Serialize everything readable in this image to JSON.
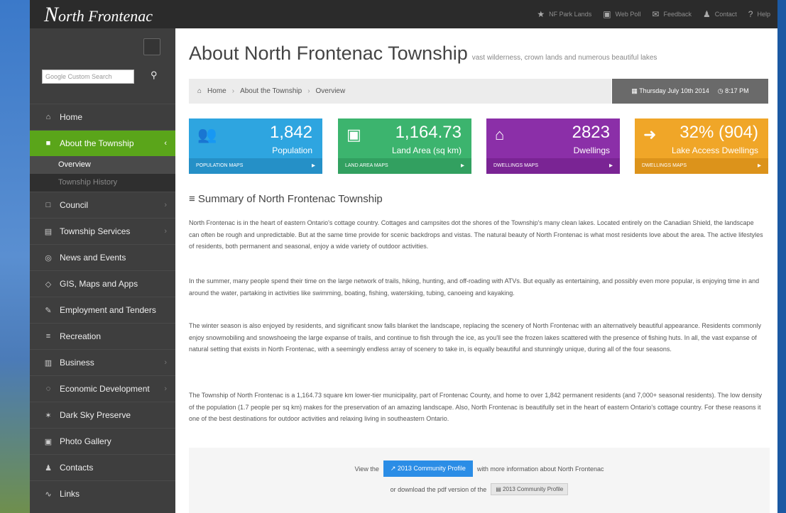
{
  "site": {
    "logo_initial": "N",
    "logo_rest": "orth Frontenac"
  },
  "topnav": [
    {
      "icon": "star-icon",
      "glyph": "★",
      "label": "NF Park Lands"
    },
    {
      "icon": "image-icon",
      "glyph": "▣",
      "label": "Web Poll"
    },
    {
      "icon": "comment-icon",
      "glyph": "✉",
      "label": "Feedback"
    },
    {
      "icon": "user-icon",
      "glyph": "♟",
      "label": "Contact"
    },
    {
      "icon": "help-icon",
      "glyph": "?",
      "label": "Help"
    }
  ],
  "sidebar": {
    "search_placeholder": "Google Custom Search",
    "items": [
      {
        "icon": "home-icon",
        "glyph": "⌂",
        "label": "Home"
      },
      {
        "icon": "book-icon",
        "glyph": "■",
        "label": "About the Township"
      },
      {
        "icon": "council-icon",
        "glyph": "□",
        "label": "Council"
      },
      {
        "icon": "services-icon",
        "glyph": "▤",
        "label": "Township Services"
      },
      {
        "icon": "news-icon",
        "glyph": "◎",
        "label": "News and Events"
      },
      {
        "icon": "map-icon",
        "glyph": "◇",
        "label": "GIS, Maps and Apps"
      },
      {
        "icon": "wrench-icon",
        "glyph": "✎",
        "label": "Employment and Tenders"
      },
      {
        "icon": "recreation-icon",
        "glyph": "≡",
        "label": "Recreation"
      },
      {
        "icon": "business-icon",
        "glyph": "▥",
        "label": "Business"
      },
      {
        "icon": "development-icon",
        "glyph": "◌",
        "label": "Economic Development"
      },
      {
        "icon": "star-icon",
        "glyph": "✶",
        "label": "Dark Sky Preserve"
      },
      {
        "icon": "photo-icon",
        "glyph": "▣",
        "label": "Photo Gallery"
      },
      {
        "icon": "contacts-icon",
        "glyph": "♟",
        "label": "Contacts"
      },
      {
        "icon": "link-icon",
        "glyph": "∿",
        "label": "Links"
      }
    ],
    "subitems": [
      "Overview",
      "Township History"
    ]
  },
  "page": {
    "title": "About North Frontenac Township",
    "subtitle": "vast wilderness, crown lands and numerous beautiful lakes"
  },
  "breadcrumb": [
    "Home",
    "About the Township",
    "Overview"
  ],
  "date": {
    "day": "Thursday July 10th 2014",
    "time": "8:17 PM"
  },
  "stats": [
    {
      "icon": "users-icon",
      "glyph": "👥",
      "value": "1,842",
      "label": "Population",
      "footer": "POPULATION MAPS"
    },
    {
      "icon": "image-icon",
      "glyph": "▣",
      "value": "1,164.73",
      "label": "Land Area (sq km)",
      "footer": "LAND AREA MAPS"
    },
    {
      "icon": "home-icon",
      "glyph": "⌂",
      "value": "2823",
      "label": "Dwellings",
      "footer": "DWELLINGS MAPS"
    },
    {
      "icon": "signin-icon",
      "glyph": "➜",
      "value": "32% (904)",
      "label": "Lake Access Dwellings",
      "footer": "DWELLINGS MAPS"
    }
  ],
  "summary": {
    "title": "Summary of North Frontenac Township",
    "paragraphs": [
      "North Frontenac is in the heart of eastern Ontario's cottage country. Cottages and campsites dot the shores of the Township's many clean lakes. Located entirely on the Canadian Shield, the landscape can often be rough and unpredictable. But at the same time provide for scenic backdrops and vistas. The natural beauty of North Frontenac is what most residents love about the area. The active lifestyles of residents, both permanent and seasonal, enjoy a wide variety of outdoor activities.",
      "In the summer, many people spend their time on the large network of trails, hiking, hunting, and off-roading with ATVs. But equally as entertaining, and possibly even more popular, is enjoying time in and around the water, partaking in activities like swimming, boating, fishing, waterskiing, tubing, canoeing and kayaking.",
      "The winter season is also enjoyed by residents, and significant snow falls blanket the landscape, replacing the scenery of North Frontenac with an alternatively beautiful appearance. Residents commonly enjoy snowmobiling and snowshoeing the large expanse of trails, and continue to fish through the ice, as you'll see the frozen lakes scattered with the presence of fishing huts. In all, the vast expanse of natural setting that exists in North Frontenac, with a seemingly endless array of scenery to take in, is equally beautiful and stunningly unique, during all of the four seasons.",
      "The Township of North Frontenac is a 1,164.73 square km lower-tier municipality, part of Frontenac County, and home to over 1,842 permanent residents (and 7,000+ seasonal residents). The low density of the population (1.7 people per sq km) makes for the preservation of an amazing landscape. Also, North Frontenac is beautifully set in the heart of eastern Ontario's cottage country. For these reasons it one of the best destinations for outdoor activities and relaxing living in southeastern Ontario."
    ]
  },
  "cta": {
    "prefix": "View the",
    "button": "2013 Community Profile",
    "suffix": "with more information about North Frontenac",
    "download_prefix": "or download the pdf version of the",
    "download_button": "2013 Community Profile"
  }
}
